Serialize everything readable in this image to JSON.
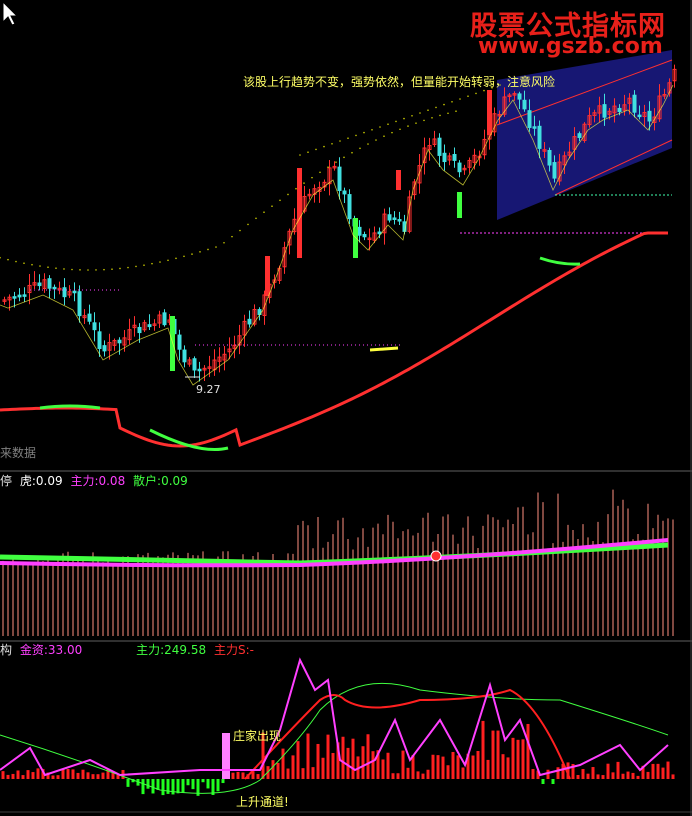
{
  "watermark": {
    "name": "股票公式指标网",
    "url": "www.gszb.com"
  },
  "main_panel": {
    "annotation": "该股上行趋势不变，强势依然，但量能开始转弱，注意风险",
    "low_price_label": "9.27",
    "no_data_label": "来数据"
  },
  "indicator_panel": {
    "label_prefix": "停",
    "items": [
      {
        "name": "虎:",
        "value": "0.09",
        "color": "#ffffff"
      },
      {
        "name": "主力:",
        "value": "0.08",
        "color": "#ff40ff"
      },
      {
        "name": "散户:",
        "value": "0.09",
        "color": "#40ff40"
      }
    ]
  },
  "structure_panel": {
    "label_prefix": "构",
    "items": [
      {
        "name": "金资:",
        "value": "33.00",
        "color": "#ff40ff"
      },
      {
        "name": "主力:",
        "value": "249.58",
        "color": "#40ff40"
      },
      {
        "name": "主力S:",
        "value": "-",
        "color": "#ff3030"
      }
    ],
    "annotations": {
      "dealer_appears": "庄家出现",
      "up_channel": "上升通道!"
    }
  },
  "colors": {
    "background": "#000000",
    "up_candle": "#ff3030",
    "down_candle": "#40e0e0",
    "dots_yellow": "#c8c800",
    "volume_bar": "#ff9080",
    "channel_fill": "#1a1a80"
  }
}
